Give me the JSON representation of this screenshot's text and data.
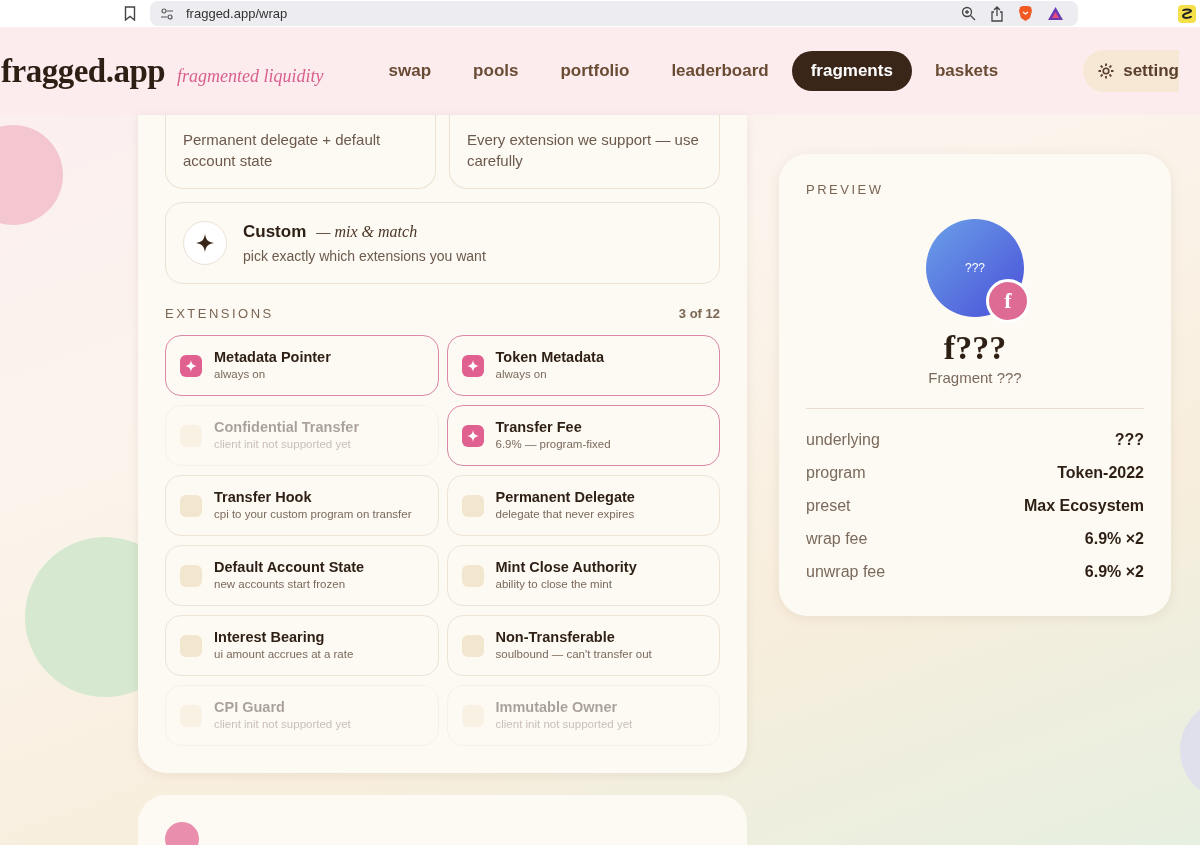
{
  "browser": {
    "url": "fragged.app/wrap"
  },
  "header": {
    "logo": "fragged.app",
    "tagline": "fragmented liquidity",
    "nav": [
      {
        "label": "swap",
        "selected": false
      },
      {
        "label": "pools",
        "selected": false
      },
      {
        "label": "portfolio",
        "selected": false
      },
      {
        "label": "leaderboard",
        "selected": false
      },
      {
        "label": "fragments",
        "selected": true
      },
      {
        "label": "baskets",
        "selected": false
      }
    ],
    "settings_label": "setting"
  },
  "presets": [
    {
      "description": "Permanent delegate + default account state"
    },
    {
      "description": "Every extension we support — use carefully"
    }
  ],
  "custom": {
    "title": "Custom",
    "subtitle": "— mix & match",
    "description": "pick exactly which extensions you want"
  },
  "extensions": {
    "heading": "EXTENSIONS",
    "count": "3 of 12",
    "items": [
      {
        "name": "Metadata Pointer",
        "note": "always on",
        "checked": true,
        "disabled": false
      },
      {
        "name": "Token Metadata",
        "note": "always on",
        "checked": true,
        "disabled": false
      },
      {
        "name": "Confidential Transfer",
        "note": "client init not supported yet",
        "checked": false,
        "disabled": true
      },
      {
        "name": "Transfer Fee",
        "note": "6.9% — program-fixed",
        "checked": true,
        "disabled": false
      },
      {
        "name": "Transfer Hook",
        "note": "cpi to your custom program on transfer",
        "checked": false,
        "disabled": false
      },
      {
        "name": "Permanent Delegate",
        "note": "delegate that never expires",
        "checked": false,
        "disabled": false
      },
      {
        "name": "Default Account State",
        "note": "new accounts start frozen",
        "checked": false,
        "disabled": false
      },
      {
        "name": "Mint Close Authority",
        "note": "ability to close the mint",
        "checked": false,
        "disabled": false
      },
      {
        "name": "Interest Bearing",
        "note": "ui amount accrues at a rate",
        "checked": false,
        "disabled": false
      },
      {
        "name": "Non-Transferable",
        "note": "soulbound — can't transfer out",
        "checked": false,
        "disabled": false
      },
      {
        "name": "CPI Guard",
        "note": "client init not supported yet",
        "checked": false,
        "disabled": true
      },
      {
        "name": "Immutable Owner",
        "note": "client init not supported yet",
        "checked": false,
        "disabled": true
      }
    ]
  },
  "preview": {
    "heading": "PREVIEW",
    "coin_label": "???",
    "badge_letter": "f",
    "symbol": "f???",
    "name": "Fragment ???",
    "rows": [
      {
        "label": "underlying",
        "value": "???"
      },
      {
        "label": "program",
        "value": "Token-2022"
      },
      {
        "label": "preset",
        "value": "Max Ecosystem"
      },
      {
        "label": "wrap fee",
        "value": "6.9% ×2"
      },
      {
        "label": "unwrap fee",
        "value": "6.9% ×2"
      }
    ]
  }
}
